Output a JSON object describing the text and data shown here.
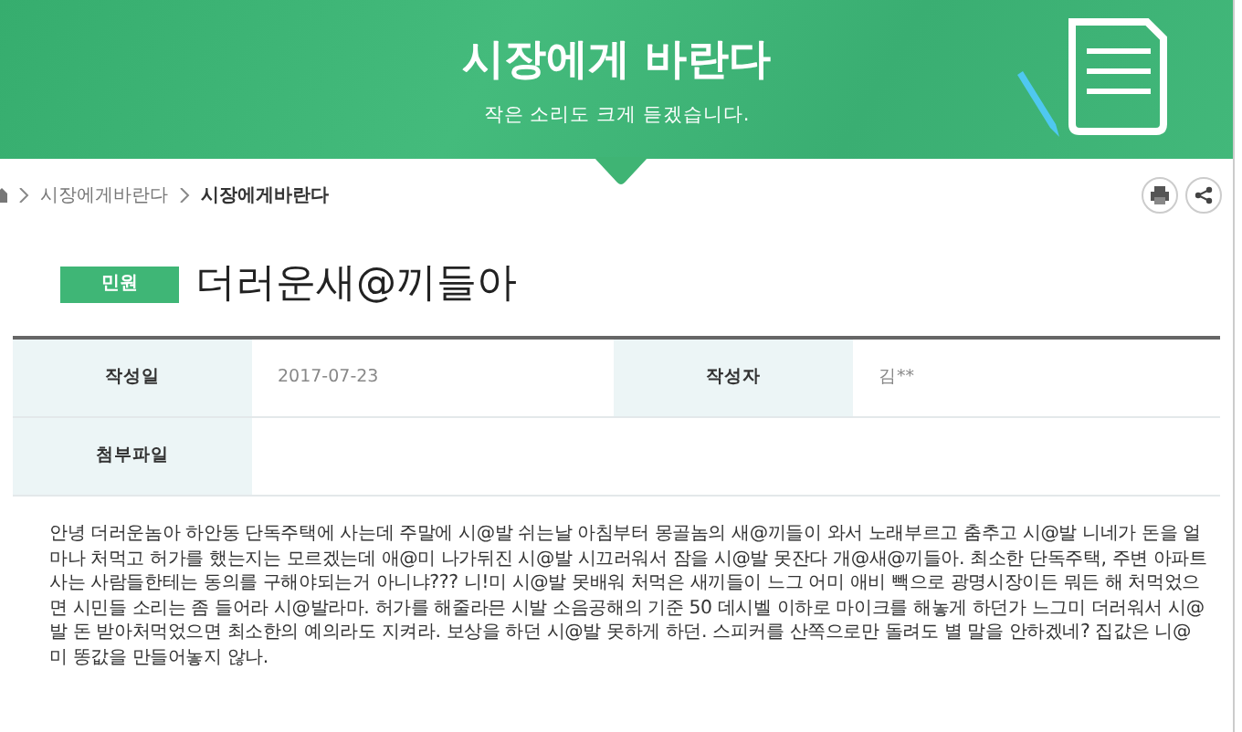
{
  "header": {
    "title": "시장에게 바란다",
    "subtitle": "작은 소리도 크게 듣겠습니다."
  },
  "breadcrumb": [
    {
      "label": "시장에게바란다",
      "current": false
    },
    {
      "label": "시장에게바란다",
      "current": true
    }
  ],
  "post": {
    "category": "민원",
    "title": "더러운새@끼들아"
  },
  "info": [
    {
      "label": "작성일",
      "value": "2017-07-23"
    },
    {
      "label": "작성자",
      "value": "김**"
    },
    {
      "label": "첨부파일"
    }
  ],
  "body": "안녕 더러운놈아 하안동 단독주택에 사는데 주말에 시@발 쉬는날 아침부터 몽골놈의 새@끼들이 와서 노래부르고 춤추고 시@발 니네가 돈을 얼마나 처먹고 허가를 했는지는 모르겠는데 애@미 나가뒤진 시@발 시끄러워서 잠을 시@발 못잔다 개@새@끼들아. 최소한 단독주택, 주변 아파트 사는 사람들한테는 동의를 구해야되는거 아니냐??? 니!미 시@발 못배워 처먹은 새끼들이 느그 어미 애비 빽으로 광명시장이든 뭐든 해 처먹었으면 시민들 소리는 좀 들어라 시@발라마. 허가를 해줄라믄 시발 소음공해의 기준 50 데시벨 이하로 마이크를 해놓게 하던가 느그미 더러워서 시@발 돈 받아처먹었으면 최소한의 예의라도 지켜라. 보상을 하던 시@발 못하게 하던. 스피커를 산쪽으로만 돌려도 별 말을 안하겠네? 집값은 니@미 똥값을 만들어놓지 않나."
}
